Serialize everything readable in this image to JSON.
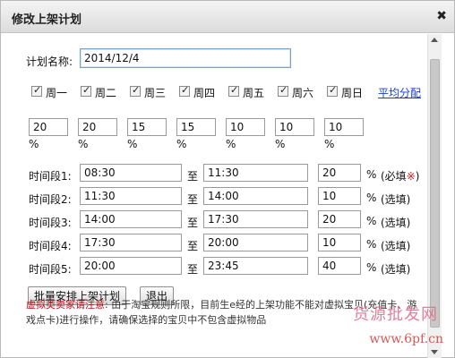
{
  "dialog": {
    "title": "修改上架计划",
    "close_icon": "close-icon"
  },
  "plan": {
    "name_label": "计划名称:",
    "name_value": "2014/12/4"
  },
  "days": [
    "周一",
    "周二",
    "周三",
    "周四",
    "周五",
    "周六",
    "周日"
  ],
  "avg_link": "平均分配",
  "percents": [
    "20",
    "20",
    "15",
    "15",
    "10",
    "10",
    "10"
  ],
  "pct_sign": "%",
  "to_label": "至",
  "slots": [
    {
      "label": "时间段1:",
      "start": "08:30",
      "end": "11:30",
      "pct": "20",
      "note": "(必填",
      "req": "※",
      "note_close": ")"
    },
    {
      "label": "时间段2:",
      "start": "11:30",
      "end": "14:00",
      "pct": "10",
      "note": "(选填)",
      "req": "",
      "note_close": ""
    },
    {
      "label": "时间段3:",
      "start": "14:00",
      "end": "17:30",
      "pct": "20",
      "note": "(选填)",
      "req": "",
      "note_close": ""
    },
    {
      "label": "时间段4:",
      "start": "17:30",
      "end": "20:00",
      "pct": "10",
      "note": "(选填)",
      "req": "",
      "note_close": ""
    },
    {
      "label": "时间段5:",
      "start": "20:00",
      "end": "23:45",
      "pct": "40",
      "note": "(选填)",
      "req": "",
      "note_close": ""
    }
  ],
  "buttons": {
    "batch": "批量安排上架计划",
    "exit": "退出"
  },
  "notice": {
    "highlight": "虚拟类卖家请注意",
    "text": ": 由于淘宝规则所限，目前生e经的上架功能不能对虚拟宝贝(充值卡、游戏点卡)进行操作，请确保选择的宝贝中不包含虚拟物品"
  },
  "watermark": {
    "line1": "货源批发网",
    "line2": "www.6pf.cn"
  }
}
